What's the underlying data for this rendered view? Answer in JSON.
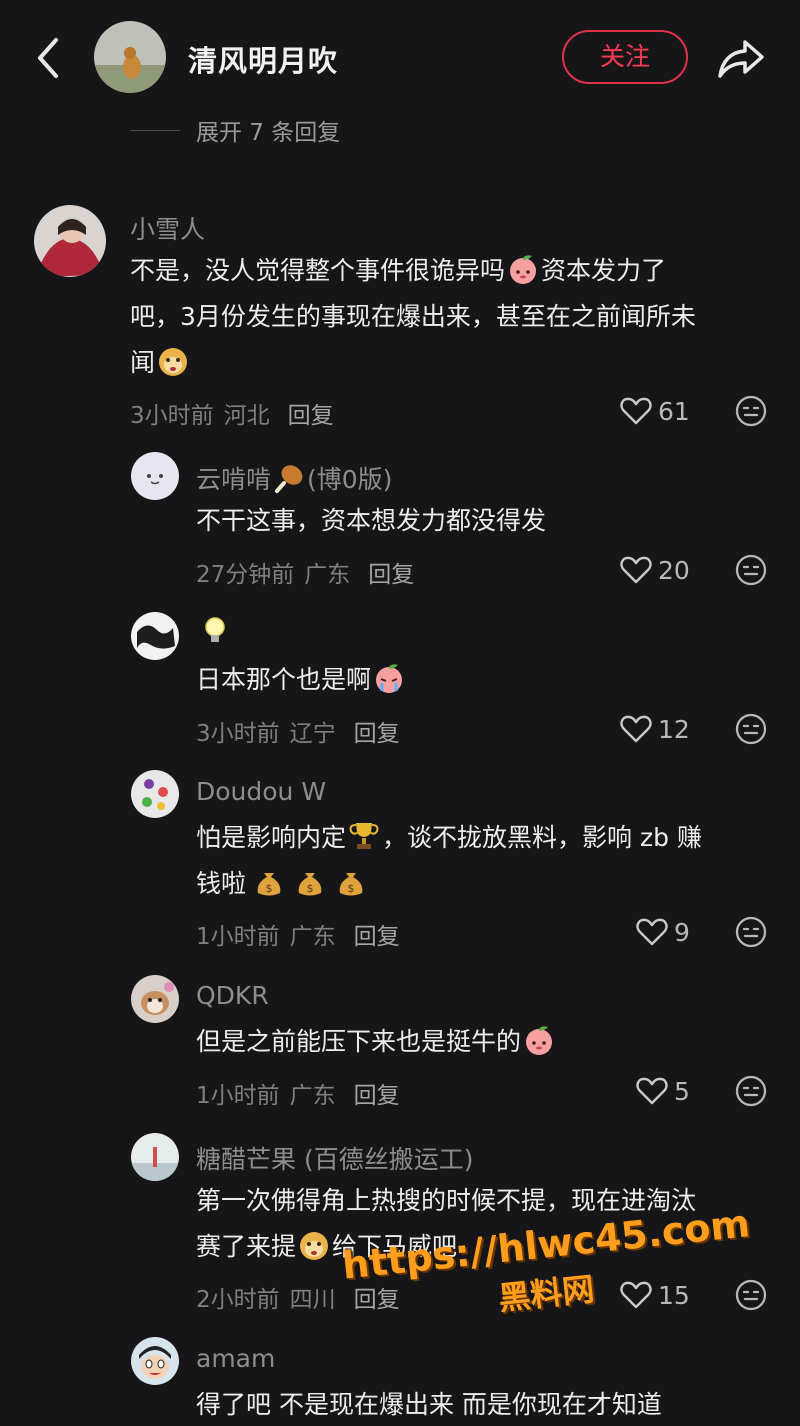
{
  "header": {
    "username": "清风明月吹",
    "follow_label": "关注"
  },
  "expand_replies": "展开 7 条回复",
  "comments": [
    {
      "username": "小雪人",
      "text_line1": "不是，没人觉得整个事件很诡异吗",
      "text_line1b": "资本发力了",
      "text_line2": "吧，3月份发生的事现在爆出来，甚至在之前闻所未",
      "text_line3": "闻",
      "time": "3小时前",
      "location": "河北",
      "reply_label": "回复",
      "likes": "61"
    },
    {
      "username": "云啃啃",
      "username_suffix": "(博0版)",
      "text": "不干这事，资本想发力都没得发",
      "time": "27分钟前",
      "location": "广东",
      "reply_label": "回复",
      "likes": "20"
    },
    {
      "username": "",
      "text": "日本那个也是啊",
      "time": "3小时前",
      "location": "辽宁",
      "reply_label": "回复",
      "likes": "12"
    },
    {
      "username": "Doudou W",
      "text_line1a": "怕是影响内定",
      "text_line1b": "，谈不拢放黑料，影响 zb 赚",
      "text_line2": "钱啦",
      "time": "1小时前",
      "location": "广东",
      "reply_label": "回复",
      "likes": "9"
    },
    {
      "username": "QDKR",
      "text": "但是之前能压下来也是挺牛的",
      "time": "1小时前",
      "location": "广东",
      "reply_label": "回复",
      "likes": "5"
    },
    {
      "username": "糖醋芒果 (百德丝搬运工)",
      "text_line1": "第一次佛得角上热搜的时候不提，现在进淘汰",
      "text_line2a": "赛了来提",
      "text_line2b": "给下马威吧",
      "time": "2小时前",
      "location": "四川",
      "reply_label": "回复",
      "likes": "15"
    },
    {
      "username": "amam",
      "text": "得了吧 不是现在爆出来 而是你现在才知道"
    }
  ],
  "watermark": {
    "url": "https://hlwc45.com",
    "name": "黑料网"
  },
  "colors": {
    "background": "#161618",
    "accent": "#e0334b",
    "watermark": "#ff9d1c"
  },
  "icons": [
    "back-icon",
    "share-icon",
    "heart-icon",
    "more-icon",
    "peach-emoji",
    "monkey-emoji",
    "drumstick-emoji",
    "lightbulb-emoji",
    "trophy-emoji",
    "money-bag-emoji"
  ]
}
